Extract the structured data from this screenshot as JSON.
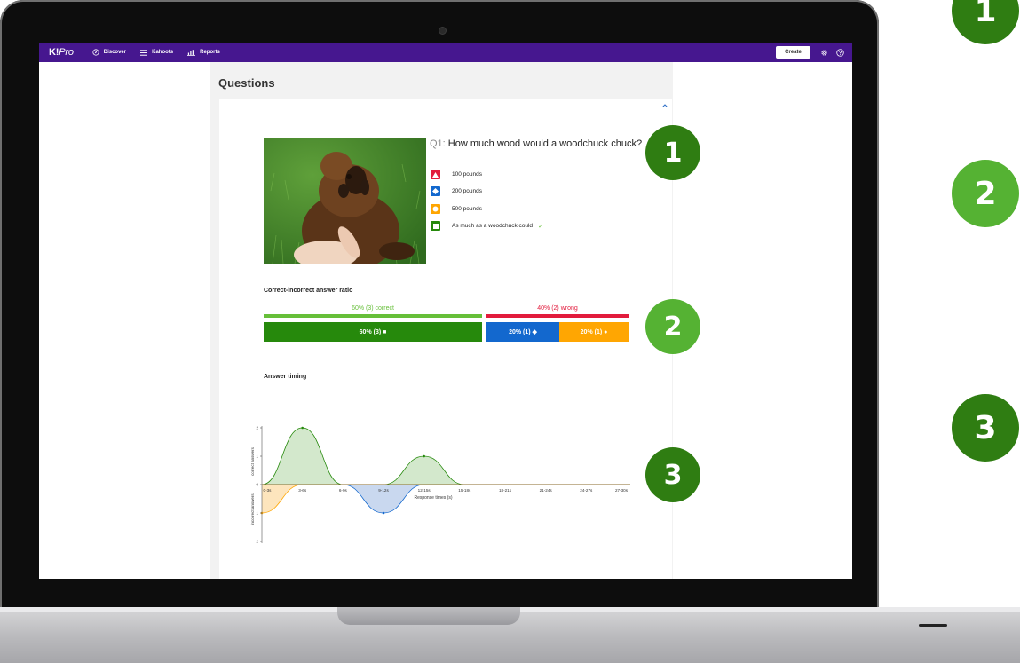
{
  "nav": {
    "logo_main": "K!",
    "logo_sub": "Pro",
    "items": [
      {
        "label": "Discover",
        "icon": "compass-icon"
      },
      {
        "label": "Kahoots",
        "icon": "list-icon"
      },
      {
        "label": "Reports",
        "icon": "bar-chart-icon"
      }
    ],
    "create_label": "Create",
    "settings_icon": "gear-icon",
    "help_icon": "help-icon"
  },
  "page": {
    "heading": "Questions",
    "collapse_icon": "chevron-up-icon"
  },
  "question": {
    "number": "Q1:",
    "text": "How much wood would a woodchuck chuck?",
    "image_alt": "woodchuck-photo",
    "answers": [
      {
        "label": "100 pounds",
        "shape": "triangle",
        "color": "#e21b3c",
        "correct": false
      },
      {
        "label": "200 pounds",
        "shape": "diamond",
        "color": "#1368ce",
        "correct": false
      },
      {
        "label": "500 pounds",
        "shape": "circle",
        "color": "#ffa602",
        "correct": false
      },
      {
        "label": "As much as a woodchuck could",
        "shape": "square",
        "color": "#26890c",
        "correct": true
      }
    ],
    "correct_mark": "✓"
  },
  "ratio": {
    "title": "Correct-incorrect answer ratio",
    "correct_label": "60% (3) correct",
    "wrong_label": "40% (2) wrong",
    "correct_fraction": 0.6,
    "segments": [
      {
        "label": "60% (3) ■",
        "fraction": 0.6,
        "color": "#26890c"
      },
      {
        "label": "20% (1) ◆",
        "fraction": 0.2,
        "color": "#1368ce"
      },
      {
        "label": "20% (1) ●",
        "fraction": 0.2,
        "color": "#ffa602"
      }
    ],
    "colors": {
      "correct_line": "#66bf39",
      "wrong_line": "#e21b3c"
    }
  },
  "timing": {
    "title": "Answer timing"
  },
  "chart_data": {
    "type": "area",
    "xlabel": "Response times (s)",
    "ylabel_top": "correct answers",
    "ylabel_bottom": "incorrect answers",
    "categories": [
      "0-3s",
      "3-6s",
      "6-9s",
      "9-12s",
      "12-15s",
      "15-18s",
      "18-21s",
      "21-24s",
      "24-27s",
      "27-30s"
    ],
    "series": [
      {
        "name": "correct answers",
        "color": "#26890c",
        "fill": "#d3e8cc",
        "values": [
          0,
          2,
          0,
          0,
          1,
          0,
          0,
          0,
          0,
          0
        ]
      },
      {
        "name": "incorrect answers",
        "color": "#ffa602",
        "fill": "#fde5bd",
        "values": [
          1,
          0,
          0,
          0,
          0,
          0,
          0,
          0,
          0,
          0
        ]
      },
      {
        "name": "incorrect answers",
        "color": "#1368ce",
        "fill": "#c9d8ef",
        "values": [
          0,
          0,
          0,
          1,
          0,
          0,
          0,
          0,
          0,
          0
        ]
      }
    ],
    "yticks_top": [
      "2",
      "1"
    ],
    "yticks_bottom": [
      "1",
      "2"
    ],
    "y_zero": "0",
    "ylim": [
      -2,
      2
    ]
  },
  "badges": [
    {
      "label": "1",
      "tone": "dark"
    },
    {
      "label": "2",
      "tone": "light"
    },
    {
      "label": "3",
      "tone": "dark"
    }
  ]
}
